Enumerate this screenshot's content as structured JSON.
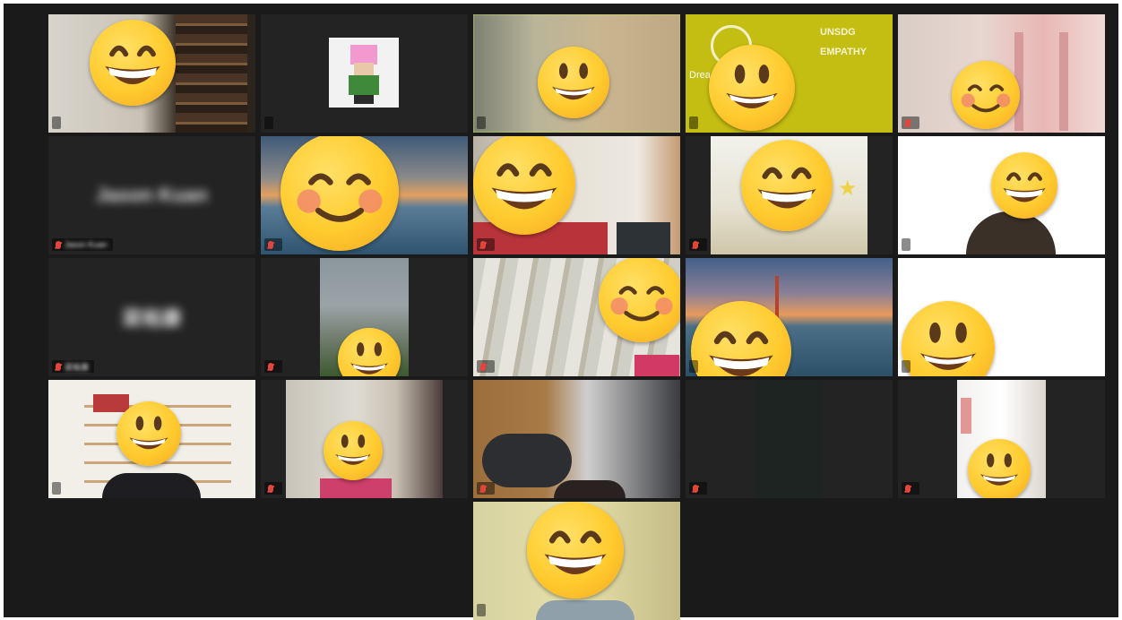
{
  "app": {
    "title": ""
  },
  "colors": {
    "background": "#1a1a1a",
    "tile": "#232323",
    "active_speaker_border": "#c8dc5a",
    "muted_mic": "#e0463c"
  },
  "participants": [
    {
      "id": "p1",
      "display_name": "",
      "muted": false
    },
    {
      "id": "p2",
      "display_name": "",
      "muted": false
    },
    {
      "id": "p3",
      "display_name": "",
      "muted": false,
      "active_speaker": true
    },
    {
      "id": "p4",
      "display_name": "",
      "muted": false,
      "background_text": [
        "UNSDG",
        "EMPATHY",
        "Drea"
      ]
    },
    {
      "id": "p5",
      "display_name": "",
      "muted": true
    },
    {
      "id": "p6",
      "display_name": "Jason Kuan",
      "muted": true
    },
    {
      "id": "p7",
      "display_name": "",
      "muted": true
    },
    {
      "id": "p8",
      "display_name": "",
      "muted": true
    },
    {
      "id": "p9",
      "display_name": "",
      "muted": true
    },
    {
      "id": "p10",
      "display_name": "",
      "muted": false
    },
    {
      "id": "p11",
      "display_name": "梁裕康",
      "muted": true
    },
    {
      "id": "p12",
      "display_name": "",
      "muted": true
    },
    {
      "id": "p13",
      "display_name": "",
      "muted": true
    },
    {
      "id": "p14",
      "display_name": "",
      "muted": false
    },
    {
      "id": "p15",
      "display_name": "",
      "muted": false
    },
    {
      "id": "p16",
      "display_name": "",
      "muted": false
    },
    {
      "id": "p17",
      "display_name": "",
      "muted": true
    },
    {
      "id": "p18",
      "display_name": "",
      "muted": true
    },
    {
      "id": "p19",
      "display_name": "",
      "muted": true
    },
    {
      "id": "p20",
      "display_name": "",
      "muted": true
    },
    {
      "id": "p21",
      "display_name": "",
      "muted": false
    }
  ],
  "icons": {
    "emoji_big_grin": "grinning-face-with-big-eyes-icon",
    "emoji_blush": "smiling-face-with-smiling-eyes-icon",
    "emoji_smile": "grinning-face-icon",
    "mic_muted": "mic-muted-icon"
  }
}
